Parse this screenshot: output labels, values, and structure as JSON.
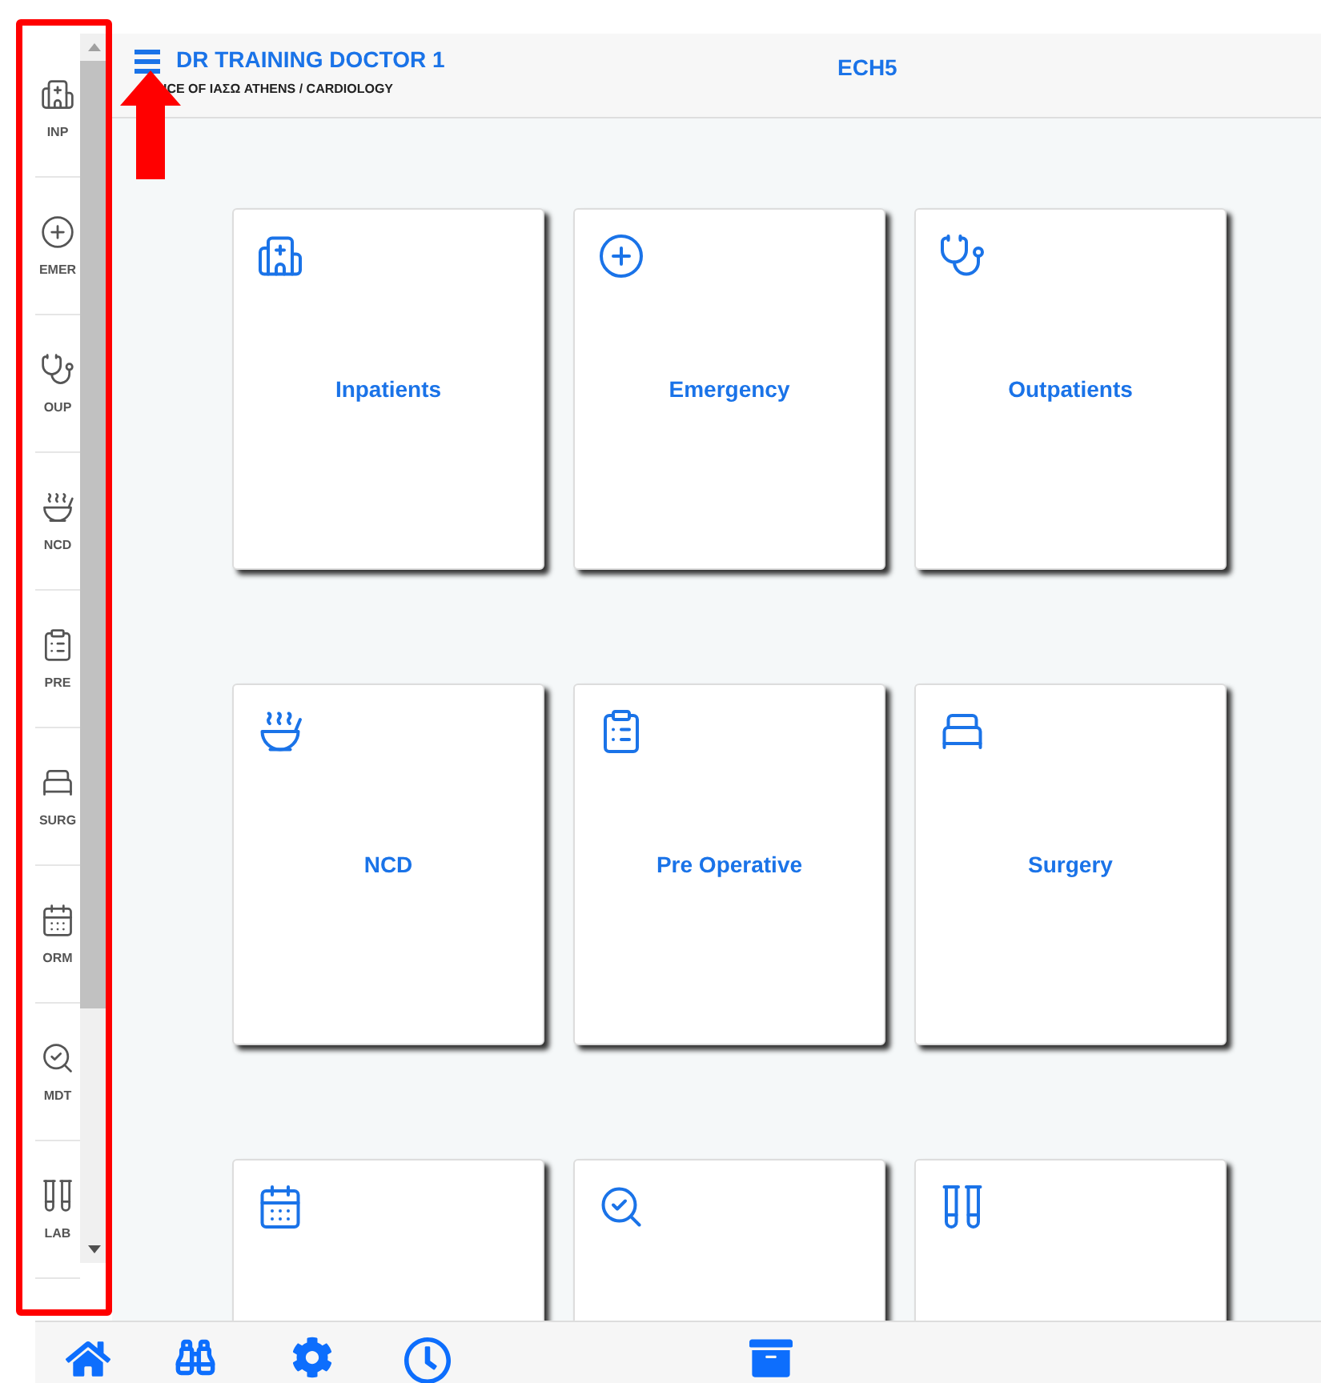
{
  "sidebar": {
    "items": [
      {
        "label": "INP"
      },
      {
        "label": "EMER"
      },
      {
        "label": "OUP"
      },
      {
        "label": "NCD"
      },
      {
        "label": "PRE"
      },
      {
        "label": "SURG"
      },
      {
        "label": "ORM"
      },
      {
        "label": "MDT"
      },
      {
        "label": "LAB"
      }
    ]
  },
  "header": {
    "title": "DR TRAINING DOCTOR 1",
    "subtitle": "ICE OF ΙΑΣΩ ATHENS / CARDIOLOGY",
    "center_title": "ECH5"
  },
  "cards": [
    {
      "kind": "full",
      "label": "Inpatients"
    },
    {
      "kind": "full",
      "label": "Emergency"
    },
    {
      "kind": "full",
      "label": "Outpatients"
    },
    {
      "kind": "full",
      "label": "NCD"
    },
    {
      "kind": "full",
      "label": "Pre Operative"
    },
    {
      "kind": "full",
      "label": "Surgery"
    },
    {
      "kind": "cut_off"
    },
    {
      "kind": "cut_off"
    },
    {
      "kind": "cut_off"
    }
  ]
}
